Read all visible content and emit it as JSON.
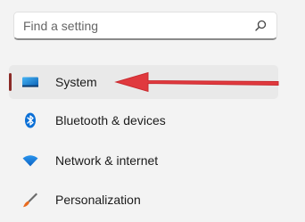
{
  "search": {
    "placeholder": "Find a setting",
    "icon": "search-icon"
  },
  "sidebar": {
    "items": [
      {
        "label": "System",
        "icon": "system-display-icon",
        "selected": true
      },
      {
        "label": "Bluetooth & devices",
        "icon": "bluetooth-icon",
        "selected": false
      },
      {
        "label": "Network & internet",
        "icon": "wifi-icon",
        "selected": false
      },
      {
        "label": "Personalization",
        "icon": "brush-icon",
        "selected": false
      }
    ]
  },
  "colors": {
    "selection_indicator": "#8b2b27",
    "annotation_arrow": "#e0393e",
    "accent": "#0078d4"
  }
}
